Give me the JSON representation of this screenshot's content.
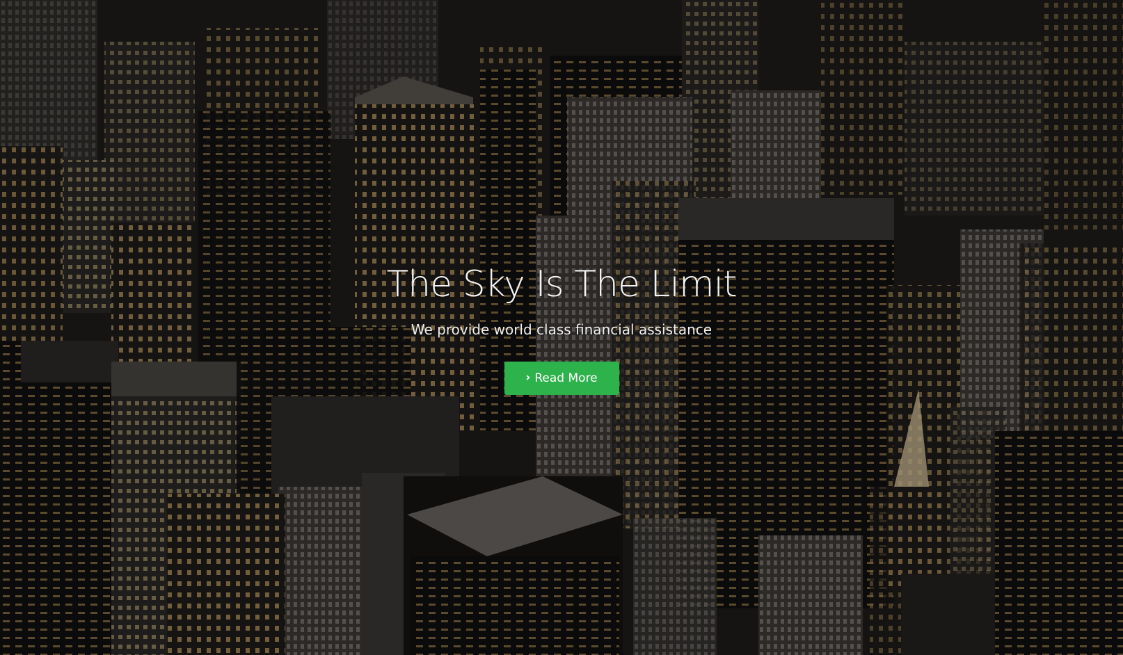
{
  "hero": {
    "title": "The Sky Is The Limit",
    "subtitle": "We provide world class financial assistance",
    "button": {
      "label": "Read More",
      "icon": "chevron-right-icon",
      "color": "#2eb24c"
    },
    "background_image": "night city skyline aerial view"
  }
}
